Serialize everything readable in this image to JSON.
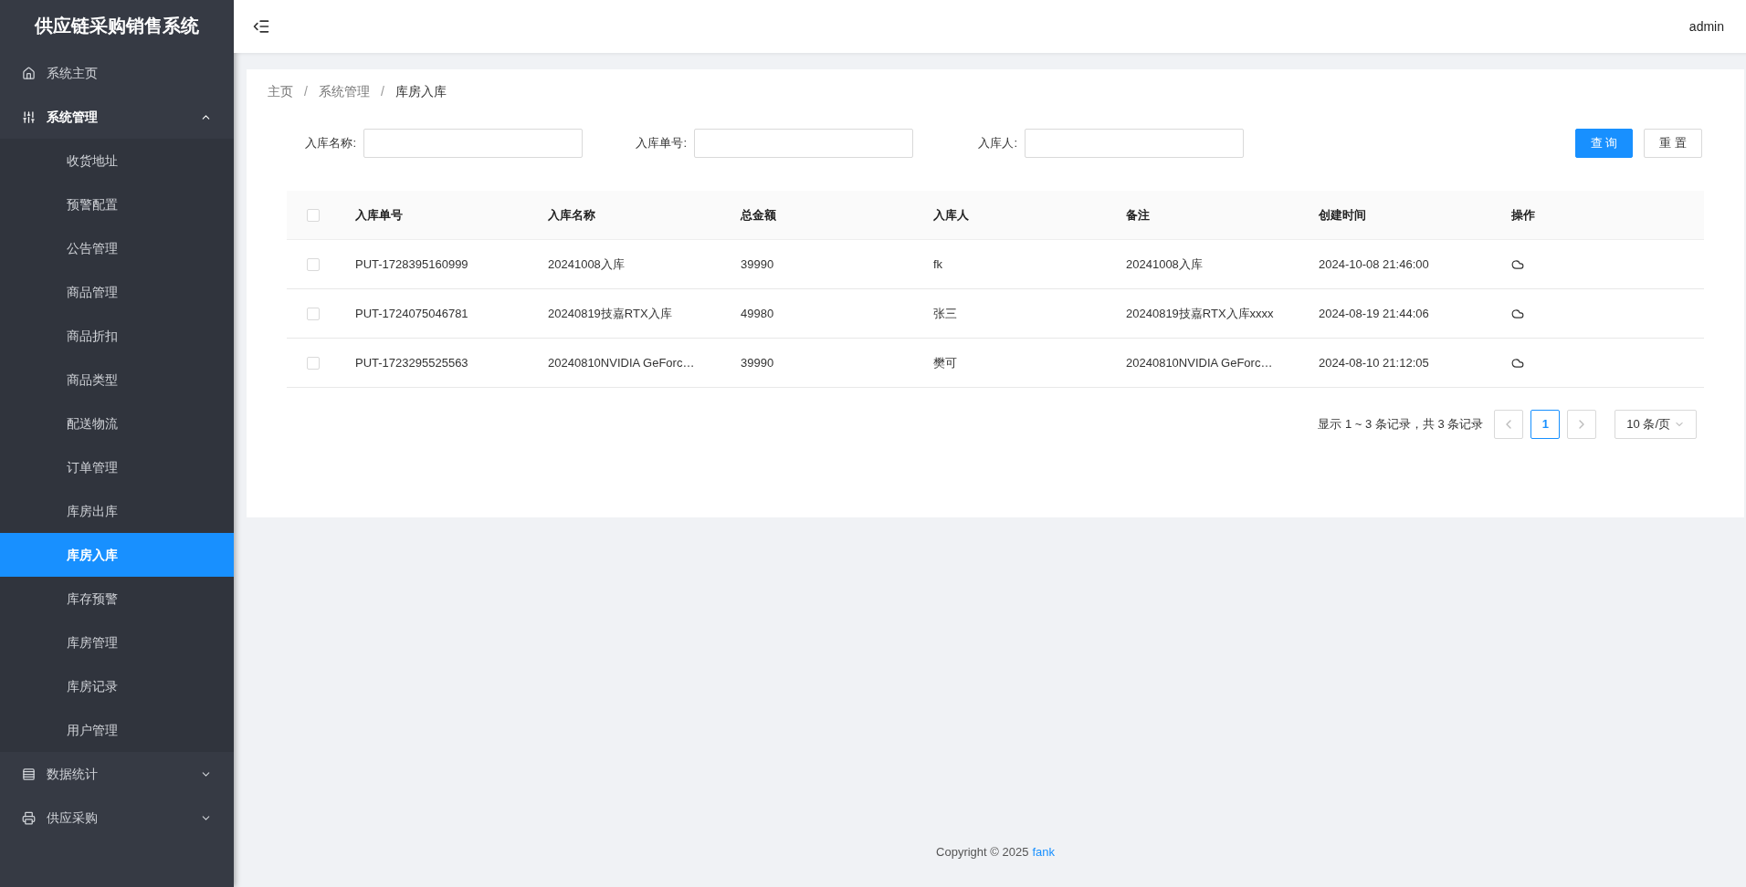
{
  "sidebar": {
    "title": "供应链采购销售系统",
    "items": [
      {
        "label": "系统主页",
        "selected": false
      },
      {
        "label": "系统管理",
        "selected": false,
        "expanded": true,
        "children": [
          {
            "label": "收货地址",
            "selected": false
          },
          {
            "label": "预警配置",
            "selected": false
          },
          {
            "label": "公告管理",
            "selected": false
          },
          {
            "label": "商品管理",
            "selected": false
          },
          {
            "label": "商品折扣",
            "selected": false
          },
          {
            "label": "商品类型",
            "selected": false
          },
          {
            "label": "配送物流",
            "selected": false
          },
          {
            "label": "订单管理",
            "selected": false
          },
          {
            "label": "库房出库",
            "selected": false
          },
          {
            "label": "库房入库",
            "selected": true
          },
          {
            "label": "库存预警",
            "selected": false
          },
          {
            "label": "库房管理",
            "selected": false
          },
          {
            "label": "库房记录",
            "selected": false
          },
          {
            "label": "用户管理",
            "selected": false
          }
        ]
      },
      {
        "label": "数据统计",
        "selected": false,
        "expanded": false
      },
      {
        "label": "供应采购",
        "selected": false,
        "expanded": false
      }
    ]
  },
  "header": {
    "user": "admin"
  },
  "breadcrumb": {
    "separator": "/",
    "items": [
      "主页",
      "系统管理",
      "库房入库"
    ]
  },
  "search": {
    "fields": [
      {
        "label": "入库名称:"
      },
      {
        "label": "入库单号:"
      },
      {
        "label": "入库人:"
      }
    ],
    "buttons": [
      "查 询",
      "重 置"
    ]
  },
  "table": {
    "select_all": {
      "checked": false
    },
    "columns": [
      "入库单号",
      "入库名称",
      "总金额",
      "入库人",
      "备注",
      "创建时间",
      "操作"
    ],
    "rows": [
      {
        "checked": false,
        "cells": [
          "PUT-1728395160999",
          "20241008入库",
          "39990",
          "fk",
          "20241008入库",
          "2024-10-08 21:46:00"
        ]
      },
      {
        "checked": false,
        "cells": [
          "PUT-1724075046781",
          "20240819技嘉RTX入库",
          "49980",
          "张三",
          "20240819技嘉RTX入库xxxx",
          "2024-08-19 21:44:06"
        ]
      },
      {
        "checked": false,
        "cells": [
          "PUT-1723295525563",
          "20240810NVIDIA GeForc…",
          "39990",
          "樊可",
          "20240810NVIDIA GeForc…",
          "2024-08-10 21:12:05"
        ]
      }
    ]
  },
  "pagination": {
    "summary": "显示 1 ~ 3 条记录，共 3 条记录",
    "pages": [
      {
        "label": "1",
        "selected": true
      }
    ],
    "page_size": "10 条/页"
  },
  "footer": {
    "copyright": "Copyright © 2025",
    "link": "fank"
  }
}
